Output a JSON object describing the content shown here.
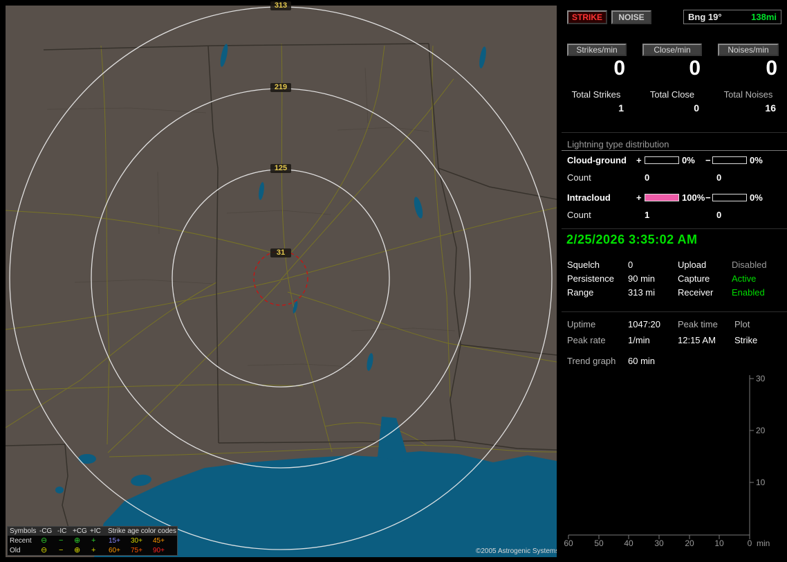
{
  "colors": {
    "accent_green": "#00dd00",
    "strike_red": "#ff3333",
    "intracloud_pink": "#ee5ca8",
    "ring_label_yellow": "#e5c94e",
    "status_disabled_gray": "#9a9a9a"
  },
  "header": {
    "strike_button": "STRIKE",
    "noise_button": "NOISE",
    "bearing": "Bng 19°",
    "distance": "138mi"
  },
  "rates": {
    "columns": [
      {
        "button": "Strikes/min",
        "value": "0",
        "total_label": "Total Strikes",
        "total_value": "1"
      },
      {
        "button": "Close/min",
        "value": "0",
        "total_label": "Total Close",
        "total_value": "0"
      },
      {
        "button": "Noises/min",
        "value": "0",
        "total_label": "Total Noises",
        "total_value": "16"
      }
    ]
  },
  "distribution": {
    "title": "Lightning type distribution",
    "rows": [
      {
        "label": "Cloud-ground",
        "plus_sign": "+",
        "plus_pct": "0%",
        "plus_fill": 0,
        "minus_sign": "−",
        "minus_pct": "0%",
        "minus_fill": 0,
        "count_label": "Count",
        "plus_count": "0",
        "minus_count": "0"
      },
      {
        "label": "Intracloud",
        "plus_sign": "+",
        "plus_pct": "100%",
        "plus_fill": 100,
        "minus_sign": "−",
        "minus_pct": "0%",
        "minus_fill": 0,
        "count_label": "Count",
        "plus_count": "1",
        "minus_count": "0"
      }
    ]
  },
  "clock": {
    "datetime": "2/25/2026 3:35:02 AM"
  },
  "settings": {
    "rows": [
      {
        "label1": "Squelch",
        "value1": "0",
        "label2": "Upload",
        "value2": "Disabled"
      },
      {
        "label1": "Persistence",
        "value1": "90 min",
        "label2": "Capture",
        "value2": "Active"
      },
      {
        "label1": "Range",
        "value1": "313 mi",
        "label2": "Receiver",
        "value2": "Enabled"
      }
    ]
  },
  "stats": {
    "uptime_label": "Uptime",
    "uptime_value": "1047:20",
    "peak_time_label": "Peak time",
    "plot_label": "Plot",
    "peak_rate_label": "Peak rate",
    "peak_rate_value": "1/min",
    "peak_time_value": "12:15 AM",
    "plot_value": "Strike",
    "trend_label": "Trend graph",
    "trend_value": "60 min"
  },
  "chart_data": {
    "type": "line",
    "title": "Strike trend graph, last 60 min",
    "series": [],
    "x_ticks": [
      "60",
      "50",
      "40",
      "30",
      "20",
      "10",
      "0"
    ],
    "x_unit": "min",
    "y_ticks": [
      "30",
      "20",
      "10"
    ],
    "ylim": [
      0,
      30
    ],
    "note": "axes drawn, no data plotted"
  },
  "map": {
    "ring_labels": [
      "313",
      "219",
      "125",
      "31"
    ],
    "legend": {
      "symbols_header": "Symbols",
      "columns": [
        "-CG",
        "-IC",
        "+CG",
        "+IC"
      ],
      "age_header": "Strike age color codes",
      "rows": [
        {
          "label": "Recent",
          "glyphs": [
            "⊖",
            "−",
            "⊕",
            "+"
          ],
          "ages": [
            "15+",
            "30+",
            "45+"
          ]
        },
        {
          "label": "Old",
          "glyphs": [
            "⊖",
            "−",
            "⊕",
            "+"
          ],
          "ages": [
            "60+",
            "75+",
            "90+"
          ]
        }
      ]
    },
    "copyright": "©2005 Astrogenic Systems"
  }
}
